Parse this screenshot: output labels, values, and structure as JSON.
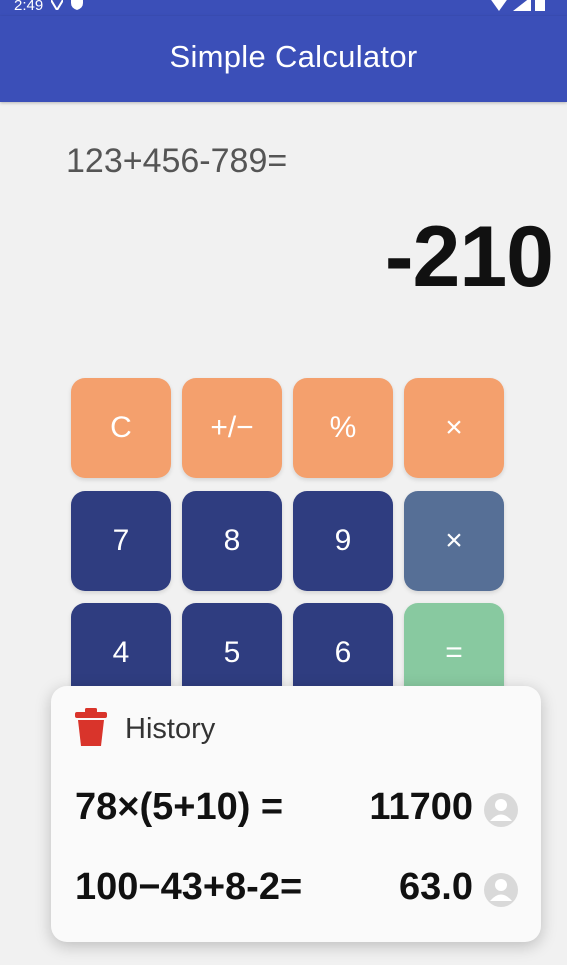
{
  "status_bar": {
    "time": "2:49"
  },
  "app_bar": {
    "title": "Simple Calculator",
    "color": "#3b4fb8"
  },
  "display": {
    "expression": "123+456-789=",
    "result": "-210"
  },
  "keypad": {
    "rows": [
      [
        "C",
        "+/−",
        "%",
        "×"
      ],
      [
        "7",
        "8",
        "9",
        "×"
      ],
      [
        "4",
        "5",
        "6",
        "="
      ]
    ],
    "colors": {
      "function": "#f4a06d",
      "digit": "#2f3d80",
      "operator": "#566f96",
      "equals": "#88c9a0"
    }
  },
  "history": {
    "title": "History",
    "entries": [
      {
        "expression": "78×(5+10) =",
        "value": "11700"
      },
      {
        "expression": "100−43+8-2=",
        "value": "63.0"
      }
    ]
  }
}
